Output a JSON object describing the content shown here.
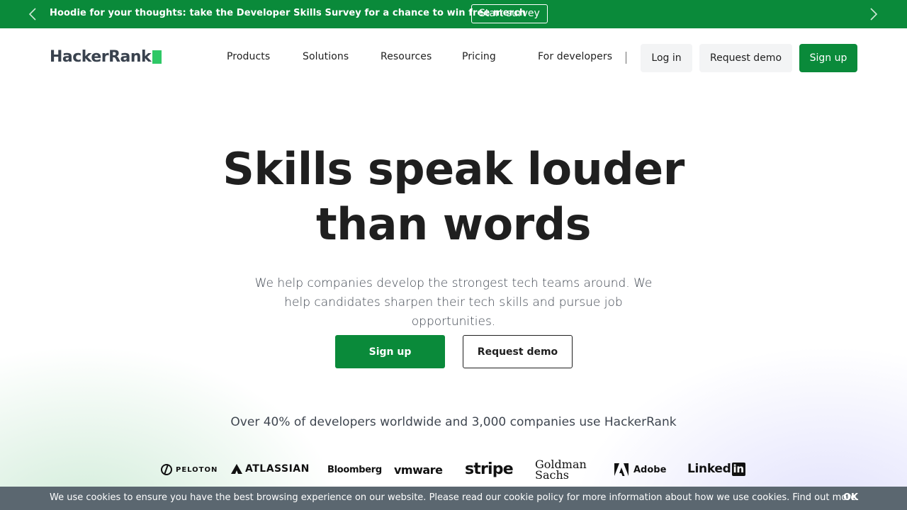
{
  "announcement": {
    "message": "Hoodie for your thoughts: take the Developer Skills Survey for a chance to win free merch",
    "button_label": "Start survey",
    "background": "#0a8a3a"
  },
  "nav": {
    "logo_text": "HackerRank",
    "items": [
      {
        "label": "Products"
      },
      {
        "label": "Solutions"
      },
      {
        "label": "Resources"
      },
      {
        "label": "Pricing"
      },
      {
        "label": "For developers"
      }
    ],
    "login_label": "Log in",
    "request_demo_label": "Request demo",
    "signup_label": "Sign up"
  },
  "hero": {
    "headline_line1": "Skills speak louder",
    "headline_line2": "than words",
    "subtext": "We help companies develop the strongest tech teams around. We help candidates sharpen their tech skills and pursue job opportunities.",
    "signup_label": "Sign up",
    "request_demo_label": "Request demo",
    "stat_line": "Over 40% of developers worldwide and 3,000 companies use HackerRank"
  },
  "logos": {
    "peloton": "PELOTON",
    "atlassian": "ATLASSIAN",
    "bloomberg": "Bloomberg",
    "vmware": "vmware",
    "stripe": "stripe",
    "goldman_line1": "Goldman",
    "goldman_line2": "Sachs",
    "adobe": "Adobe",
    "linkedin_text": "Linked",
    "linkedin_box": "in"
  },
  "cookie": {
    "text": "We use cookies to ensure you have the best browsing experience on our website. Please read our cookie policy for more information about how we use cookies. Find out more.",
    "ok_label": "OK"
  },
  "colors": {
    "brand_green": "#0a8a3a",
    "logo_green": "#2ec866",
    "cookie_bg": "#5b6770"
  }
}
